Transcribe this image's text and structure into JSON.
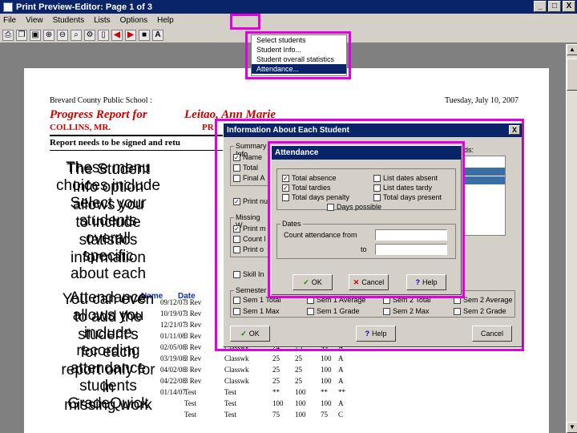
{
  "window": {
    "title": "Print Preview-Editor:  Page 1 of 3",
    "buttons": [
      "_",
      "□",
      "X"
    ]
  },
  "menubar": [
    "File",
    "View",
    "Students",
    "Lists",
    "Options",
    "Help"
  ],
  "toolbar_letter": "A",
  "dropdown": {
    "items": [
      "Select students",
      "Student Info...",
      "Student overall statistics",
      "Attendance..."
    ],
    "selected_index": 3
  },
  "report": {
    "school": "Brevard County Public School :",
    "date": "Tuesday, July 10, 2007",
    "title": "Progress Report for",
    "student": "Leitao, Ann Marie",
    "teacher": "COLLINS, MR.",
    "teacher_suffix": "PR",
    "notice": "Report needs to be signed and retu",
    "columns": [
      "Name",
      "Date"
    ],
    "rows": [
      {
        "date": "09/12/07",
        "item": "3 Rev",
        "type": "",
        "pts": "",
        "max": "",
        "pct": "",
        "grade": ""
      },
      {
        "date": "10/19/07",
        "item": "3 Rev",
        "type": "",
        "pts": "",
        "max": "",
        "pct": "",
        "grade": ""
      },
      {
        "date": "12/21/07",
        "item": "3 Rev",
        "type": "",
        "pts": "",
        "max": "",
        "pct": "",
        "grade": ""
      },
      {
        "date": "01/11/08",
        "item": "3 Rev",
        "type": "",
        "pts": "",
        "max": "",
        "pct": "",
        "grade": ""
      },
      {
        "date": "02/05/08",
        "item": "3 Rev",
        "type": "Classwk",
        "pts": "24",
        "max": "25",
        "pct": "99",
        "grade": "A"
      },
      {
        "date": "03/19/08",
        "item": "3 Rev",
        "type": "Classwk",
        "pts": "25",
        "max": "25",
        "pct": "100",
        "grade": "A"
      },
      {
        "date": "04/02/08",
        "item": "3 Rev",
        "type": "Classwk",
        "pts": "25",
        "max": "25",
        "pct": "100",
        "grade": "A"
      },
      {
        "date": "04/22/08",
        "item": "3 Rev",
        "type": "Classwk",
        "pts": "25",
        "max": "25",
        "pct": "100",
        "grade": "A"
      },
      {
        "date": "01/14/07",
        "item": "Test",
        "type": "Test",
        "pts": "**",
        "max": "100",
        "pct": "**",
        "grade": "**"
      },
      {
        "date": "",
        "item": "Test",
        "type": "Test",
        "pts": "100",
        "max": "100",
        "pct": "100",
        "grade": "A"
      },
      {
        "date": "",
        "item": "Test",
        "type": "Test",
        "pts": "75",
        "max": "100",
        "pct": "75",
        "grade": "C"
      }
    ]
  },
  "captions": {
    "stack1": [
      "These menu",
      "The Student",
      "choices include",
      "Info option",
      "Select your",
      "allows you",
      "students",
      "to include",
      "overall",
      "statistics",
      "specific",
      "information",
      "about each"
    ],
    "stack2": [
      "Attendance",
      "You can even",
      "allows you",
      "to add the",
      "include",
      "student's",
      "recording",
      "for each",
      "attendance",
      "report only for",
      "students",
      "in",
      "GradeQuick",
      "missing work"
    ]
  },
  "info_dialog": {
    "title": "Information About Each Student",
    "close": "X",
    "summary_label": "Summary Info",
    "summary_items": [
      "Name",
      "Total",
      "Final A"
    ],
    "print_label": "Print nu",
    "missing_label": "Missing W",
    "missing_items": [
      "Print m",
      "Count l",
      "Print o"
    ],
    "skill_label": "Skill In",
    "fields_label": "ds:",
    "semester_label": "Semester",
    "semester_items": [
      "Sem 1 Total",
      "Sem 1 Average",
      "Sem 2 Total",
      "Sem 2 Average",
      "Sem 1 Max",
      "Sem 1 Grade",
      "Sem 2 Max",
      "Sem 2 Grade"
    ],
    "ok": "OK",
    "help": "Help",
    "cancel": "Cancel"
  },
  "attendance_dialog": {
    "title": "Attendance",
    "checks": [
      {
        "label": "Total absence",
        "checked": true
      },
      {
        "label": "List dates absent",
        "checked": false
      },
      {
        "label": "Total tardies",
        "checked": true
      },
      {
        "label": "List dates tardy",
        "checked": false
      },
      {
        "label": "Total days penalty",
        "checked": false
      },
      {
        "label": "Total days present",
        "checked": false
      },
      {
        "label": "Days possible",
        "checked": false
      }
    ],
    "dates_label": "Dates",
    "from_label": "Count attendance from",
    "to_label": "to",
    "ok": "OK",
    "cancel": "Cancel",
    "help": "Help"
  }
}
